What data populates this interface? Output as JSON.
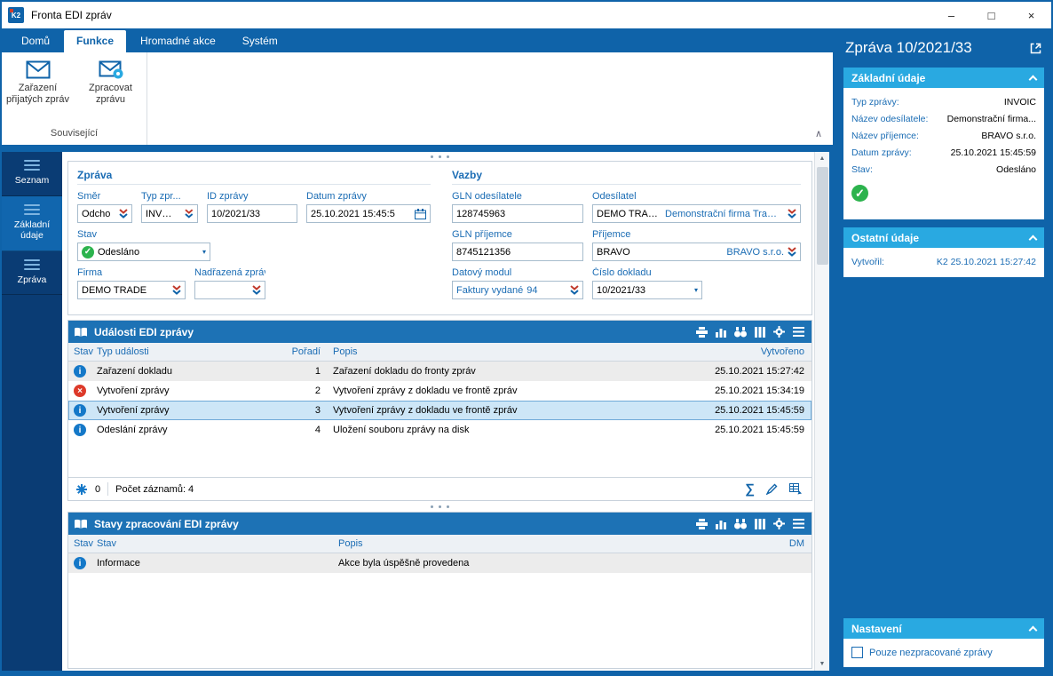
{
  "colors": {
    "primary_blue": "#0f63a9",
    "sidebar_navy": "#0a3c74",
    "panel_header_blue": "#1d72b5",
    "section_cyan": "#29a9e1",
    "label_blue": "#1a6cb4",
    "success_green": "#2cb34d",
    "error_red": "#dd3a2a",
    "info_blue": "#1478c8"
  },
  "icons": {
    "minimize": "–",
    "maximize": "□",
    "close": "×",
    "scroll_up": "▲",
    "scroll_down": "▼",
    "sum": "∑",
    "collapse": "∧",
    "check": "✓",
    "info": "i",
    "error": "×",
    "dropdown": "▾"
  },
  "window": {
    "title": "Fronta EDI zpráv",
    "app_badge": "K2"
  },
  "ribbon": {
    "tabs": {
      "domu": "Domů",
      "funkce": "Funkce",
      "hromadne": "Hromadné akce",
      "system": "Systém"
    },
    "buttons": {
      "zarazeni_line1": "Zařazení",
      "zarazeni_line2": "přijatých zpráv",
      "zpracovat_line1": "Zpracovat",
      "zpracovat_line2": "zprávu"
    },
    "group": "Související"
  },
  "sidebar": {
    "seznam": "Seznam",
    "zakladni_line1": "Základní",
    "zakladni_line2": "údaje",
    "zprava": "Zpráva"
  },
  "form": {
    "zprava_group": {
      "title": "Zpráva",
      "smer_label": "Směr",
      "smer_value": "Odcho",
      "typ_label": "Typ zpr...",
      "typ_value": "INVOIC",
      "id_label": "ID zprávy",
      "id_value": "10/2021/33",
      "datum_label": "Datum zprávy",
      "datum_value": "25.10.2021 15:45:5",
      "stav_label": "Stav",
      "stav_value": "Odesláno",
      "firma_label": "Firma",
      "firma_value": "DEMO TRADE",
      "nadrazena_label": "Nadřazená zpráva",
      "nadrazena_value": ""
    },
    "vazby_group": {
      "title": "Vazby",
      "gln_odesilatele_label": "GLN odesílatele",
      "gln_odesilatele_value": "128745963",
      "odesilatel_label": "Odesílatel",
      "odesilatel_value": "DEMO TRADE",
      "odesilatel_detail": "Demonstrační firma Trad...",
      "gln_prijemce_label": "GLN příjemce",
      "gln_prijemce_value": "8745121356",
      "prijemce_label": "Příjemce",
      "prijemce_value": "BRAVO",
      "prijemce_detail": "BRAVO s.r.o.",
      "datovy_modul_label": "Datový modul",
      "datovy_modul_value": "Faktury vydané",
      "datovy_modul_number": "94",
      "cislo_dokladu_label": "Číslo dokladu",
      "cislo_dokladu_value": "10/2021/33"
    }
  },
  "events": {
    "title": "Události EDI zprávy",
    "columns": {
      "stav": "Stav",
      "typ": "Typ události",
      "poradi": "Pořadí",
      "popis": "Popis",
      "vytvoreno": "Vytvořeno"
    },
    "rows": [
      {
        "status": "info",
        "typ": "Zařazení dokladu",
        "poradi": "1",
        "popis": "Zařazení dokladu do fronty zpráv",
        "vytvoreno": "25.10.2021 15:27:42"
      },
      {
        "status": "error",
        "typ": "Vytvoření zprávy",
        "poradi": "2",
        "popis": "Vytvoření zprávy z dokladu ve frontě zpráv",
        "vytvoreno": "25.10.2021 15:34:19"
      },
      {
        "status": "info",
        "typ": "Vytvoření zprávy",
        "poradi": "3",
        "popis": "Vytvoření zprávy z dokladu ve frontě zpráv",
        "vytvoreno": "25.10.2021 15:45:59"
      },
      {
        "status": "info",
        "typ": "Odeslání zprávy",
        "poradi": "4",
        "popis": "Uložení souboru zprávy na disk",
        "vytvoreno": "25.10.2021 15:45:59"
      }
    ],
    "footer": {
      "flag_count": "0",
      "records": "Počet záznamů: 4"
    }
  },
  "states": {
    "title": "Stavy zpracování EDI zprávy",
    "columns": {
      "stav_icon": "Stav",
      "stav": "Stav",
      "popis": "Popis",
      "dm": "DM"
    },
    "rows": [
      {
        "status": "info",
        "stav": "Informace",
        "popis": "Akce byla úspěšně provedena",
        "dm": ""
      }
    ]
  },
  "detail": {
    "title": "Zpráva 10/2021/33",
    "zakladni": {
      "title": "Základní údaje",
      "typ_label": "Typ zprávy:",
      "typ_value": "INVOIC",
      "odesilatel_label": "Název odesílatele:",
      "odesilatel_value": "Demonstrační firma...",
      "prijemce_label": "Název příjemce:",
      "prijemce_value": "BRAVO s.r.o.",
      "datum_label": "Datum zprávy:",
      "datum_value": "25.10.2021 15:45:59",
      "stav_label": "Stav:",
      "stav_value": "Odesláno"
    },
    "ostatni": {
      "title": "Ostatní údaje",
      "vytvoril_label": "Vytvořil:",
      "vytvoril_value": "K2 25.10.2021 15:27:42"
    },
    "nastaveni": {
      "title": "Nastavení",
      "checkbox_label": "Pouze nezpracované zprávy"
    }
  }
}
